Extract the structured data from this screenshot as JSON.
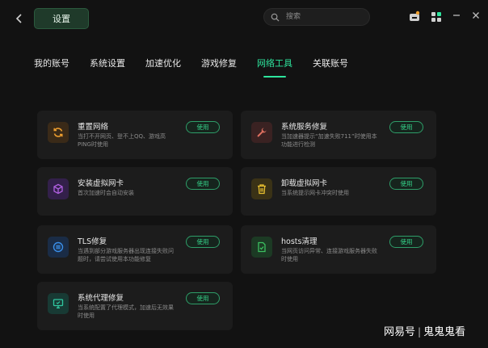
{
  "header": {
    "title": "设置",
    "search_placeholder": "搜索"
  },
  "tabs": [
    {
      "label": "我的账号"
    },
    {
      "label": "系统设置"
    },
    {
      "label": "加速优化"
    },
    {
      "label": "游戏修复"
    },
    {
      "label": "网络工具",
      "active": true
    },
    {
      "label": "关联账号"
    }
  ],
  "tools": [
    {
      "name": "重置网络",
      "desc": "当打不开网页、登不上QQ、游戏高PING时使用",
      "button": "使用",
      "icon": "refresh-icon",
      "color": "#f0a030"
    },
    {
      "name": "系统服务修复",
      "desc": "当加速器提示“加速失败711”时使用本功能进行检测",
      "button": "使用",
      "icon": "wrench-icon",
      "color": "#e07060"
    },
    {
      "name": "安装虚拟网卡",
      "desc": "首次加速时会自动安装",
      "button": "使用",
      "icon": "cube-icon",
      "color": "#b060e0"
    },
    {
      "name": "卸载虚拟网卡",
      "desc": "当系统提示网卡冲突时使用",
      "button": "使用",
      "icon": "trash-icon",
      "color": "#e8c030"
    },
    {
      "name": "TLS修复",
      "desc": "当遇到部分游戏服务器出现连接失败问题时，请尝试使用本功能修复",
      "button": "使用",
      "icon": "tls-icon",
      "color": "#3a8ee8"
    },
    {
      "name": "hosts清理",
      "desc": "当网页访问异常、连接游戏服务器失败时使用",
      "button": "使用",
      "icon": "file-clean-icon",
      "color": "#3cc060"
    },
    {
      "name": "系统代理修复",
      "desc": "当系统配置了代理模式，加速后无效果时使用",
      "button": "使用",
      "icon": "monitor-icon",
      "color": "#30c8a0"
    }
  ],
  "watermark": {
    "left": "网易号",
    "sep": "|",
    "right": "鬼鬼鬼看"
  }
}
